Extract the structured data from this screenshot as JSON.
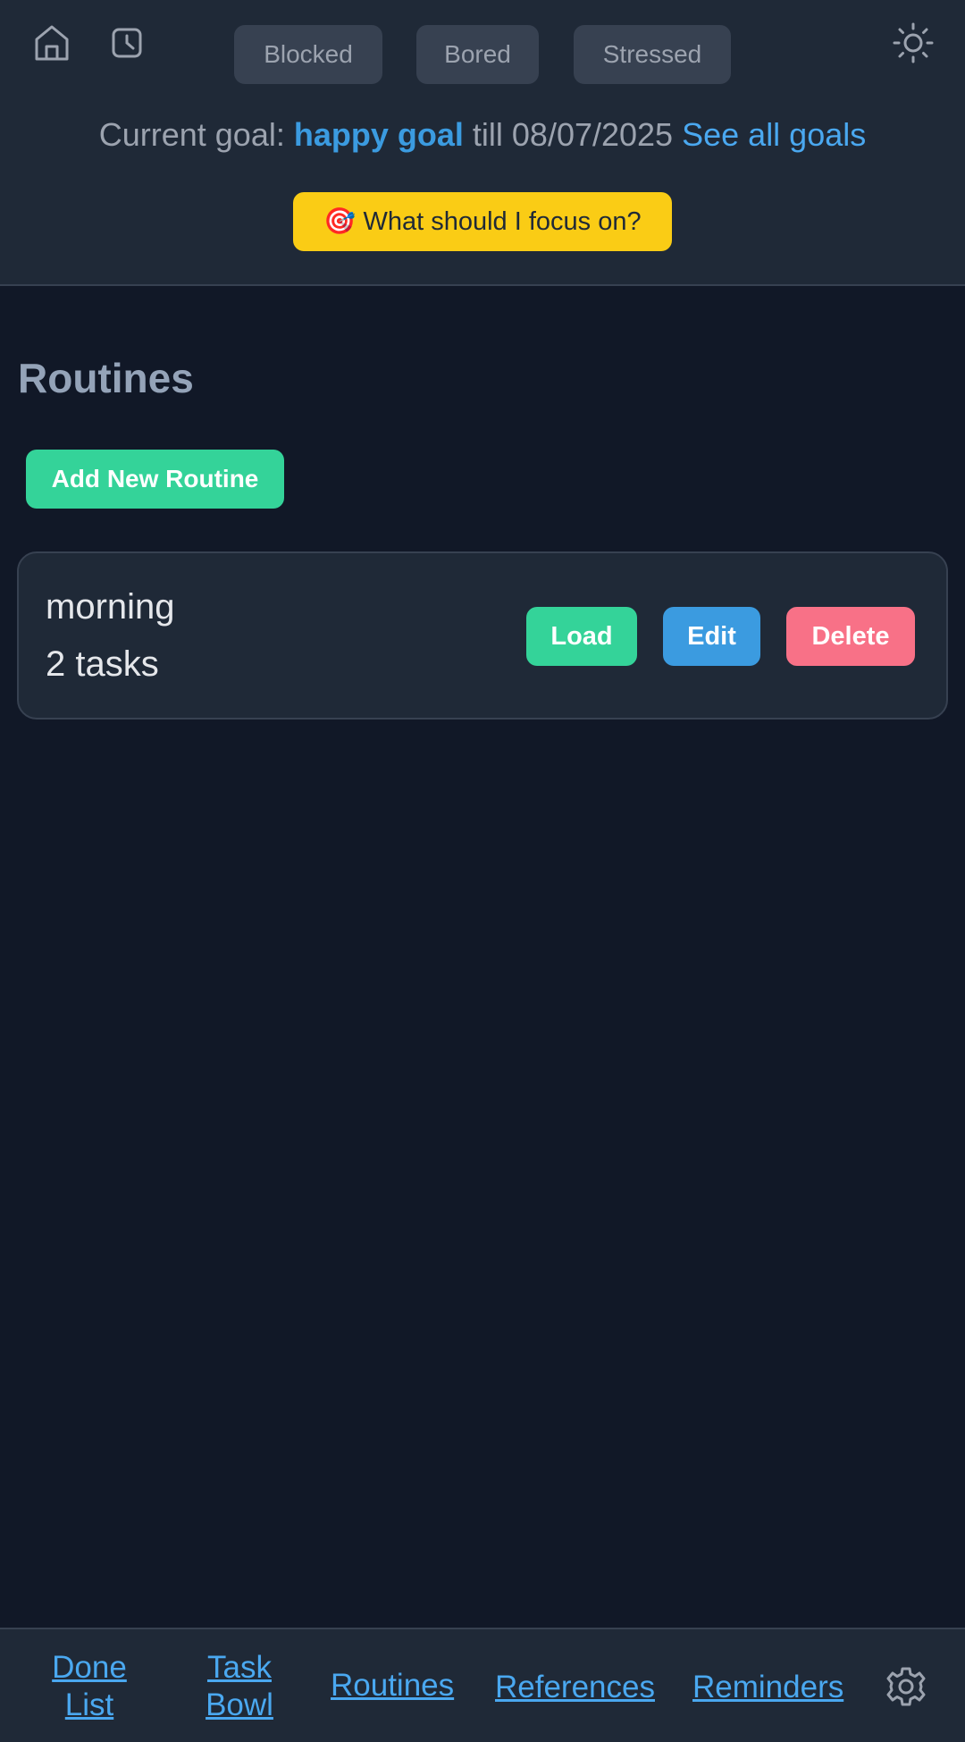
{
  "header": {
    "mood_buttons": [
      "Blocked",
      "Bored",
      "Stressed"
    ],
    "goal": {
      "prefix": "Current goal:",
      "name": "happy goal",
      "till": "till 08/07/2025",
      "see_all": "See all goals"
    },
    "focus_button": {
      "emoji": "🎯",
      "label": "What should I focus on?"
    }
  },
  "routines": {
    "title": "Routines",
    "add_label": "Add New Routine",
    "items": [
      {
        "name": "morning",
        "count": "2 tasks",
        "load_label": "Load",
        "edit_label": "Edit",
        "delete_label": "Delete"
      }
    ]
  },
  "bottom_nav": {
    "done_list": "Done List",
    "task_bowl": "Task Bowl",
    "routines": "Routines",
    "references": "References",
    "reminders": "Reminders"
  },
  "icons": {
    "home": "home-icon",
    "timer": "timer-icon",
    "theme": "sun-icon",
    "settings": "gear-icon"
  },
  "colors": {
    "background": "#111827",
    "panel": "#1f2937",
    "accent_green": "#34d399",
    "accent_blue": "#3b9be0",
    "accent_red": "#f87187",
    "accent_yellow": "#facc15"
  }
}
